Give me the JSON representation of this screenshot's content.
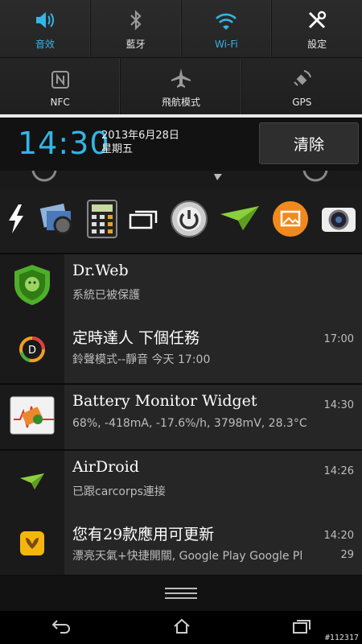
{
  "quick_toggles": [
    {
      "label": "音效",
      "icon": "volume-icon",
      "active": true
    },
    {
      "label": "藍牙",
      "icon": "bluetooth-icon",
      "active": false
    },
    {
      "label": "Wi-Fi",
      "icon": "wifi-icon",
      "active": true
    },
    {
      "label": "設定",
      "icon": "settings-tools-icon",
      "active": false
    },
    {
      "label": "NFC",
      "icon": "nfc-icon",
      "active": false
    },
    {
      "label": "飛航模式",
      "icon": "airplane-icon",
      "active": false
    },
    {
      "label": "GPS",
      "icon": "gps-icon",
      "active": false
    }
  ],
  "header": {
    "time": "14:30",
    "date": "2013年6月28日",
    "weekday": "星期五",
    "clear_label": "清除"
  },
  "app_shortcuts": [
    "flash-icon",
    "gallery-icon",
    "calculator-icon",
    "window-switch-icon",
    "power-icon",
    "airdroid-icon",
    "photo-app-icon",
    "camera-icon"
  ],
  "notifications": [
    {
      "title": "Dr.Web",
      "subtitle": "系統已被保護",
      "time": "",
      "count": "",
      "icon": "drweb-shield-icon"
    },
    {
      "title": "定時達人 下個任務",
      "subtitle": "鈴聲模式--靜音 今天 17:00",
      "time": "17:00",
      "count": "",
      "icon": "timer-app-icon"
    },
    {
      "title": "Battery Monitor Widget",
      "subtitle": "68%, -418mA, -17.6%/h, 3798mV, 28.3°C",
      "time": "14:30",
      "count": "",
      "icon": "battery-monitor-icon"
    },
    {
      "title": "AirDroid",
      "subtitle": "已跟carcorps連接",
      "time": "14:26",
      "count": "",
      "icon": "airdroid-icon"
    },
    {
      "title": "您有29款應用可更新",
      "subtitle": "漂亮天氣+快捷開關, Google Play Google Pl",
      "time": "14:20",
      "count": "29",
      "icon": "app-store-icon"
    }
  ],
  "colors": {
    "accent": "#33b5e5"
  },
  "watermark": "#112317"
}
